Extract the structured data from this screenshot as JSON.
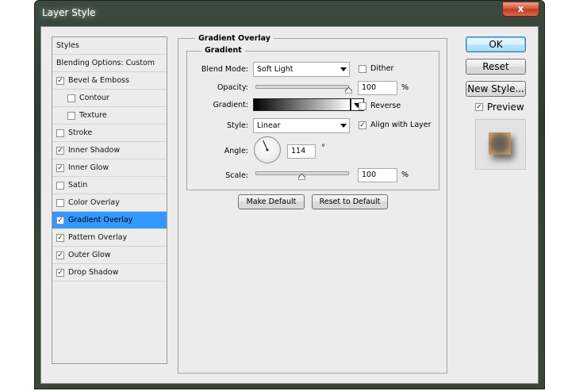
{
  "window": {
    "title": "Layer Style",
    "close_glyph": "x"
  },
  "styles_list": {
    "header": "Styles",
    "blending": "Blending Options: Custom",
    "items": [
      {
        "label": "Bevel & Emboss",
        "checked": true,
        "indent": false
      },
      {
        "label": "Contour",
        "checked": false,
        "indent": true
      },
      {
        "label": "Texture",
        "checked": false,
        "indent": true
      },
      {
        "label": "Stroke",
        "checked": false,
        "indent": false
      },
      {
        "label": "Inner Shadow",
        "checked": true,
        "indent": false
      },
      {
        "label": "Inner Glow",
        "checked": true,
        "indent": false
      },
      {
        "label": "Satin",
        "checked": false,
        "indent": false
      },
      {
        "label": "Color Overlay",
        "checked": false,
        "indent": false
      },
      {
        "label": "Gradient Overlay",
        "checked": true,
        "indent": false,
        "selected": true
      },
      {
        "label": "Pattern Overlay",
        "checked": true,
        "indent": false
      },
      {
        "label": "Outer Glow",
        "checked": true,
        "indent": false
      },
      {
        "label": "Drop Shadow",
        "checked": true,
        "indent": false
      }
    ]
  },
  "panel": {
    "section_title": "Gradient Overlay",
    "subsection_title": "Gradient",
    "blend_mode": {
      "label": "Blend Mode:",
      "value": "Soft Light"
    },
    "dither": {
      "label": "Dither",
      "checked": false
    },
    "opacity": {
      "label": "Opacity:",
      "value": "100",
      "unit": "%",
      "level": 1.0
    },
    "gradient": {
      "label": "Gradient:",
      "from_color": "#000000",
      "to_color": "#ffffff"
    },
    "reverse": {
      "label": "Reverse",
      "checked": false
    },
    "style": {
      "label": "Style:",
      "value": "Linear"
    },
    "align_with_layer": {
      "label": "Align with Layer",
      "checked": true
    },
    "angle": {
      "label": "Angle:",
      "value": "114",
      "unit": "°"
    },
    "scale": {
      "label": "Scale:",
      "value": "100",
      "unit": "%",
      "level": 0.5
    },
    "make_default": "Make Default",
    "reset_to_default": "Reset to Default"
  },
  "right": {
    "ok": "OK",
    "reset": "Reset",
    "new_style": "New Style...",
    "preview": {
      "label": "Preview",
      "checked": true
    }
  },
  "colors": {
    "selection": "#3399ff",
    "dialog_bg": "#ececec",
    "close_button": "#c13b22"
  }
}
